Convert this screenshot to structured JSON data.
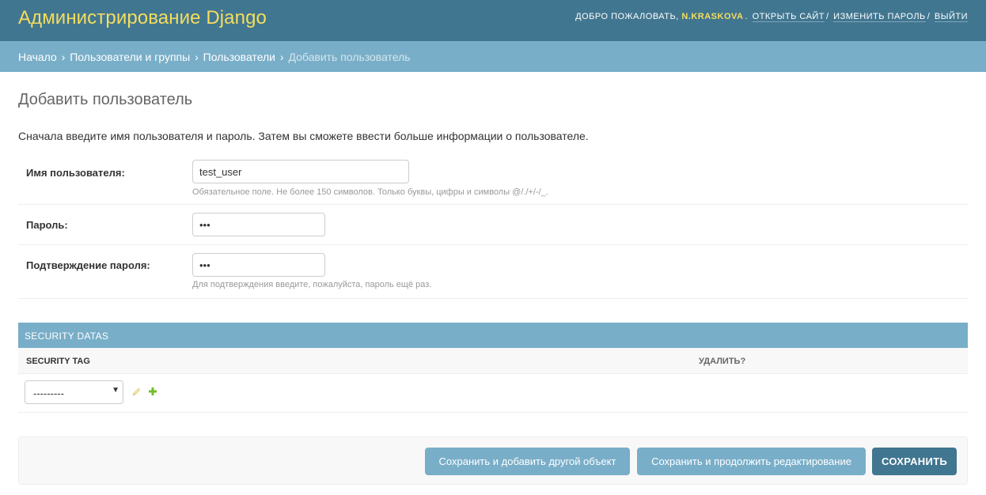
{
  "header": {
    "branding": "Администрирование Django",
    "welcome": "ДОБРО ПОЖАЛОВАТЬ,",
    "username": "N.KRASKOVA",
    "links": [
      "ОТКРЫТЬ САЙТ",
      "ИЗМЕНИТЬ ПАРОЛЬ",
      "ВЫЙТИ"
    ],
    "colors": {
      "header_bg": "#417690",
      "branding": "#f5dd5d"
    }
  },
  "breadcrumbs": {
    "items": [
      "Начало",
      "Пользователи и группы",
      "Пользователи"
    ],
    "current": "Добавить пользователь",
    "separator": "›"
  },
  "page": {
    "title": "Добавить пользователь",
    "intro": "Сначала введите имя пользователя и пароль. Затем вы сможете ввести больше информации о пользователе."
  },
  "form": {
    "username": {
      "label": "Имя пользователя:",
      "value": "test_user",
      "help": "Обязательное поле. Не более 150 символов. Только буквы, цифры и символы @/./+/-/_."
    },
    "password": {
      "label": "Пароль:",
      "value": "•••"
    },
    "password2": {
      "label": "Подтверждение пароля:",
      "value": "•••",
      "help": "Для подтверждения введите, пожалуйста, пароль ещё раз."
    }
  },
  "inline": {
    "title": "SECURITY DATAS",
    "columns": [
      "SECURITY TAG",
      "УДАЛИТЬ?"
    ],
    "select_value": "---------",
    "icons": [
      "pencil-icon",
      "plus-icon"
    ]
  },
  "submit": {
    "add_another": "Сохранить и добавить другой объект",
    "continue": "Сохранить и продолжить редактирование",
    "save": "СОХРАНИТЬ"
  }
}
